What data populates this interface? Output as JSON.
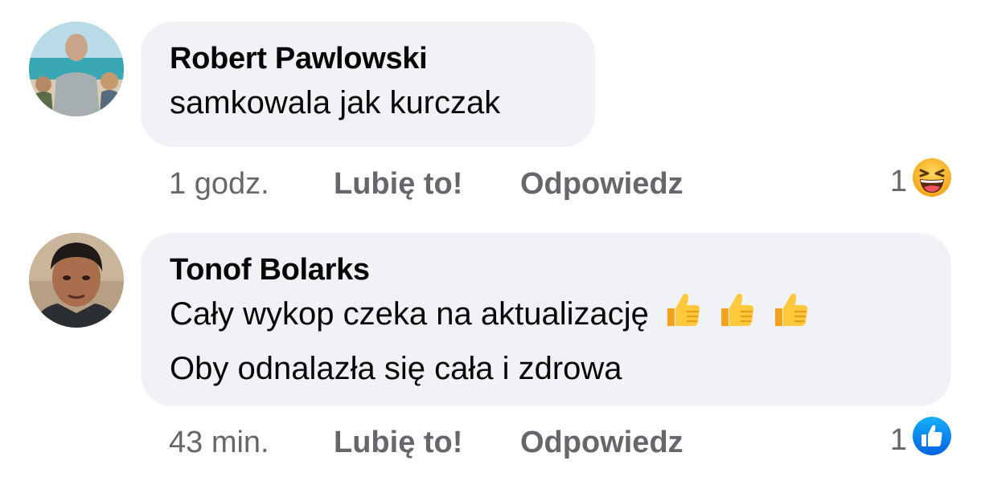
{
  "comments": [
    {
      "author": "Robert Pawlowski",
      "lines": [
        "samkowala jak kurczak"
      ],
      "time": "1 godz.",
      "like_label": "Lubię to!",
      "reply_label": "Odpowiedz",
      "reaction_count": "1",
      "reaction_icon": "laughing-face-icon"
    },
    {
      "author": "Tonof Bolarks",
      "lines": [
        "Cały wykop czeka na aktualizację",
        "Oby odnalazła się cała i zdrowa"
      ],
      "line1_emojis": [
        "thumbs-up-emoji",
        "thumbs-up-emoji",
        "thumbs-up-emoji"
      ],
      "time": "43 min.",
      "like_label": "Lubię to!",
      "reply_label": "Odpowiedz",
      "reaction_count": "1",
      "reaction_icon": "like-thumb-icon"
    }
  ],
  "colors": {
    "bubble_bg": "#f0f2f5",
    "text": "#050505",
    "meta": "#65676b",
    "like_blue": "#1877f2",
    "haha_yellow": "#f7b125"
  }
}
